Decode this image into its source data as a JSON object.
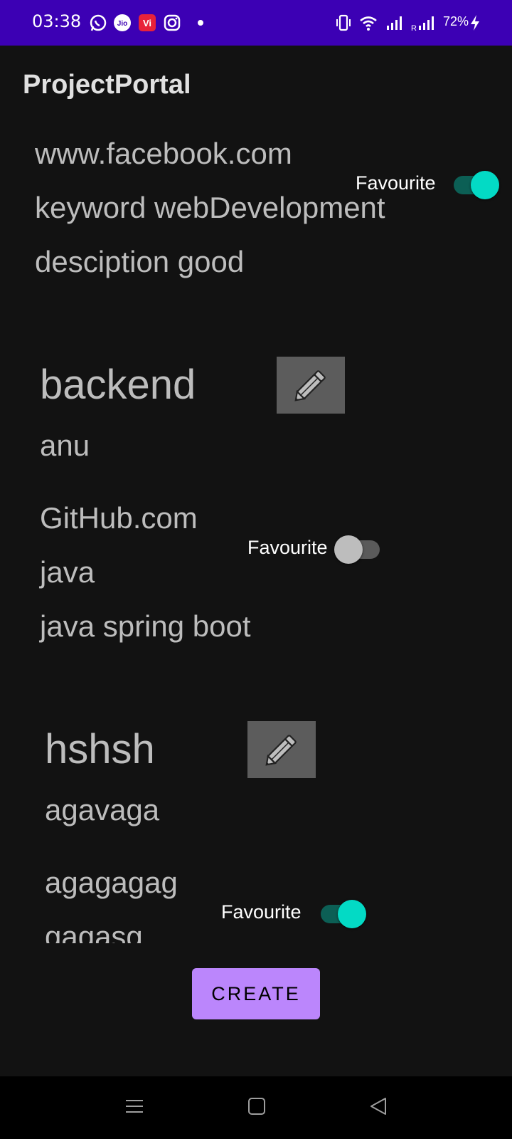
{
  "status_bar": {
    "time": "03:38",
    "battery": "72%",
    "icons": [
      "whatsapp-icon",
      "jio-icon",
      "vi-icon",
      "instagram-icon",
      "vibrate-icon",
      "wifi-icon",
      "signal-icon",
      "roaming-signal-icon",
      "charging-icon"
    ]
  },
  "app": {
    "title": "ProjectPortal"
  },
  "projects": [
    {
      "name": "",
      "author": "",
      "link": "www.facebook.com",
      "keyword": "keyword webDevelopment",
      "description": "desciption good",
      "favourite_label": "Favourite",
      "favourite": true
    },
    {
      "name": "backend",
      "author": "anu",
      "link": "GitHub.com",
      "keyword": "java",
      "description": "java spring boot",
      "favourite_label": "Favourite",
      "favourite": false
    },
    {
      "name": "hshsh",
      "author": "agavaga",
      "link": "agagagag",
      "keyword": "gagasg",
      "description": "",
      "favourite_label": "Favourite",
      "favourite": true
    }
  ],
  "actions": {
    "create_label": "CREATE"
  },
  "nav_bar": {
    "icons": [
      "menu-icon",
      "home-icon",
      "back-icon"
    ]
  },
  "colors": {
    "status_bar": "#3c00b4",
    "background": "#121212",
    "accent": "#03dac5",
    "button": "#bb86fc"
  }
}
